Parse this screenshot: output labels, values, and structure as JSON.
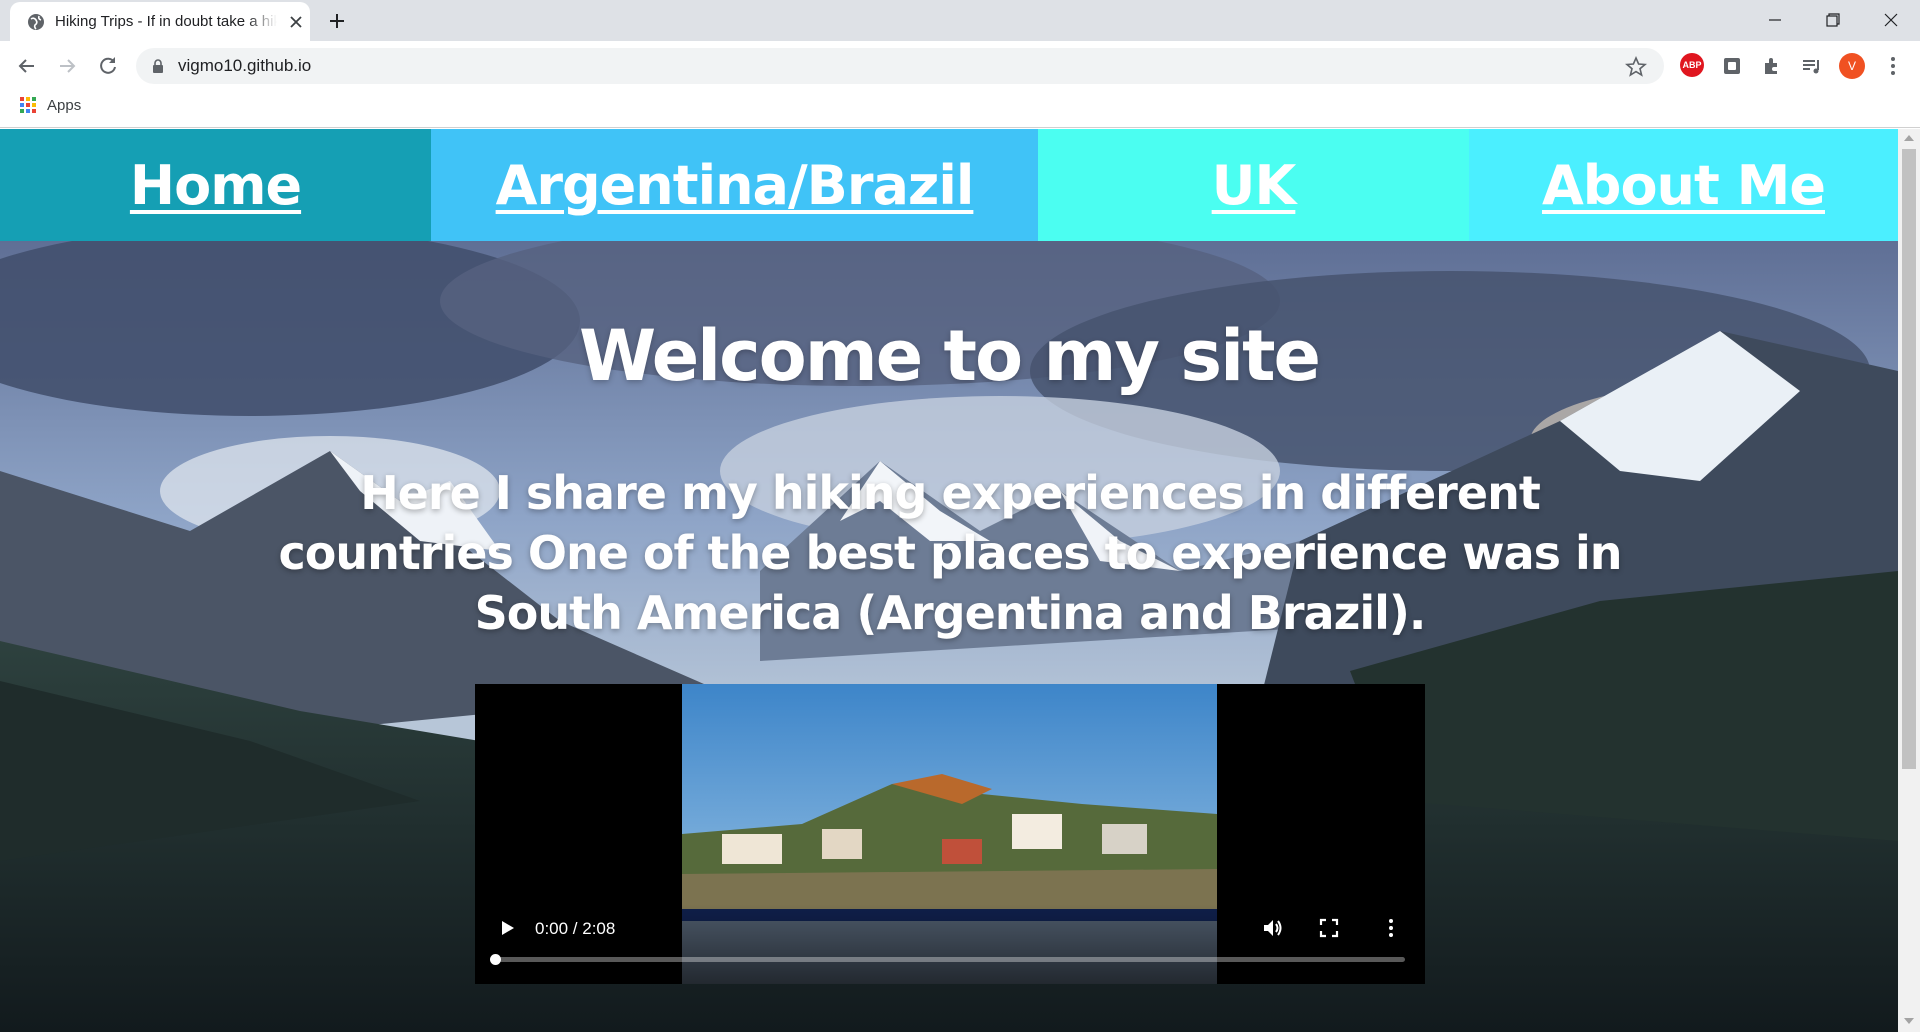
{
  "browser": {
    "tab_title": "Hiking Trips - If in doubt take a hike",
    "url": "vigmo10.github.io",
    "bookmarks": {
      "apps_label": "Apps"
    },
    "profile_initial": "V",
    "abp_label": "ABP"
  },
  "site_nav": {
    "items": [
      {
        "label": "Home",
        "color": "#159fb4"
      },
      {
        "label": "Argentina/Brazil",
        "color": "#40c3f7"
      },
      {
        "label": "UK",
        "color": "#4bfef1"
      },
      {
        "label": "About Me",
        "color": "#4befff"
      }
    ]
  },
  "hero": {
    "title": "Welcome to my site",
    "text": "Here I share my hiking experiences in different countries One of the best places to experience was in South America (Argentina and Brazil)."
  },
  "video": {
    "time": "0:00 / 2:08",
    "progress": 0
  }
}
